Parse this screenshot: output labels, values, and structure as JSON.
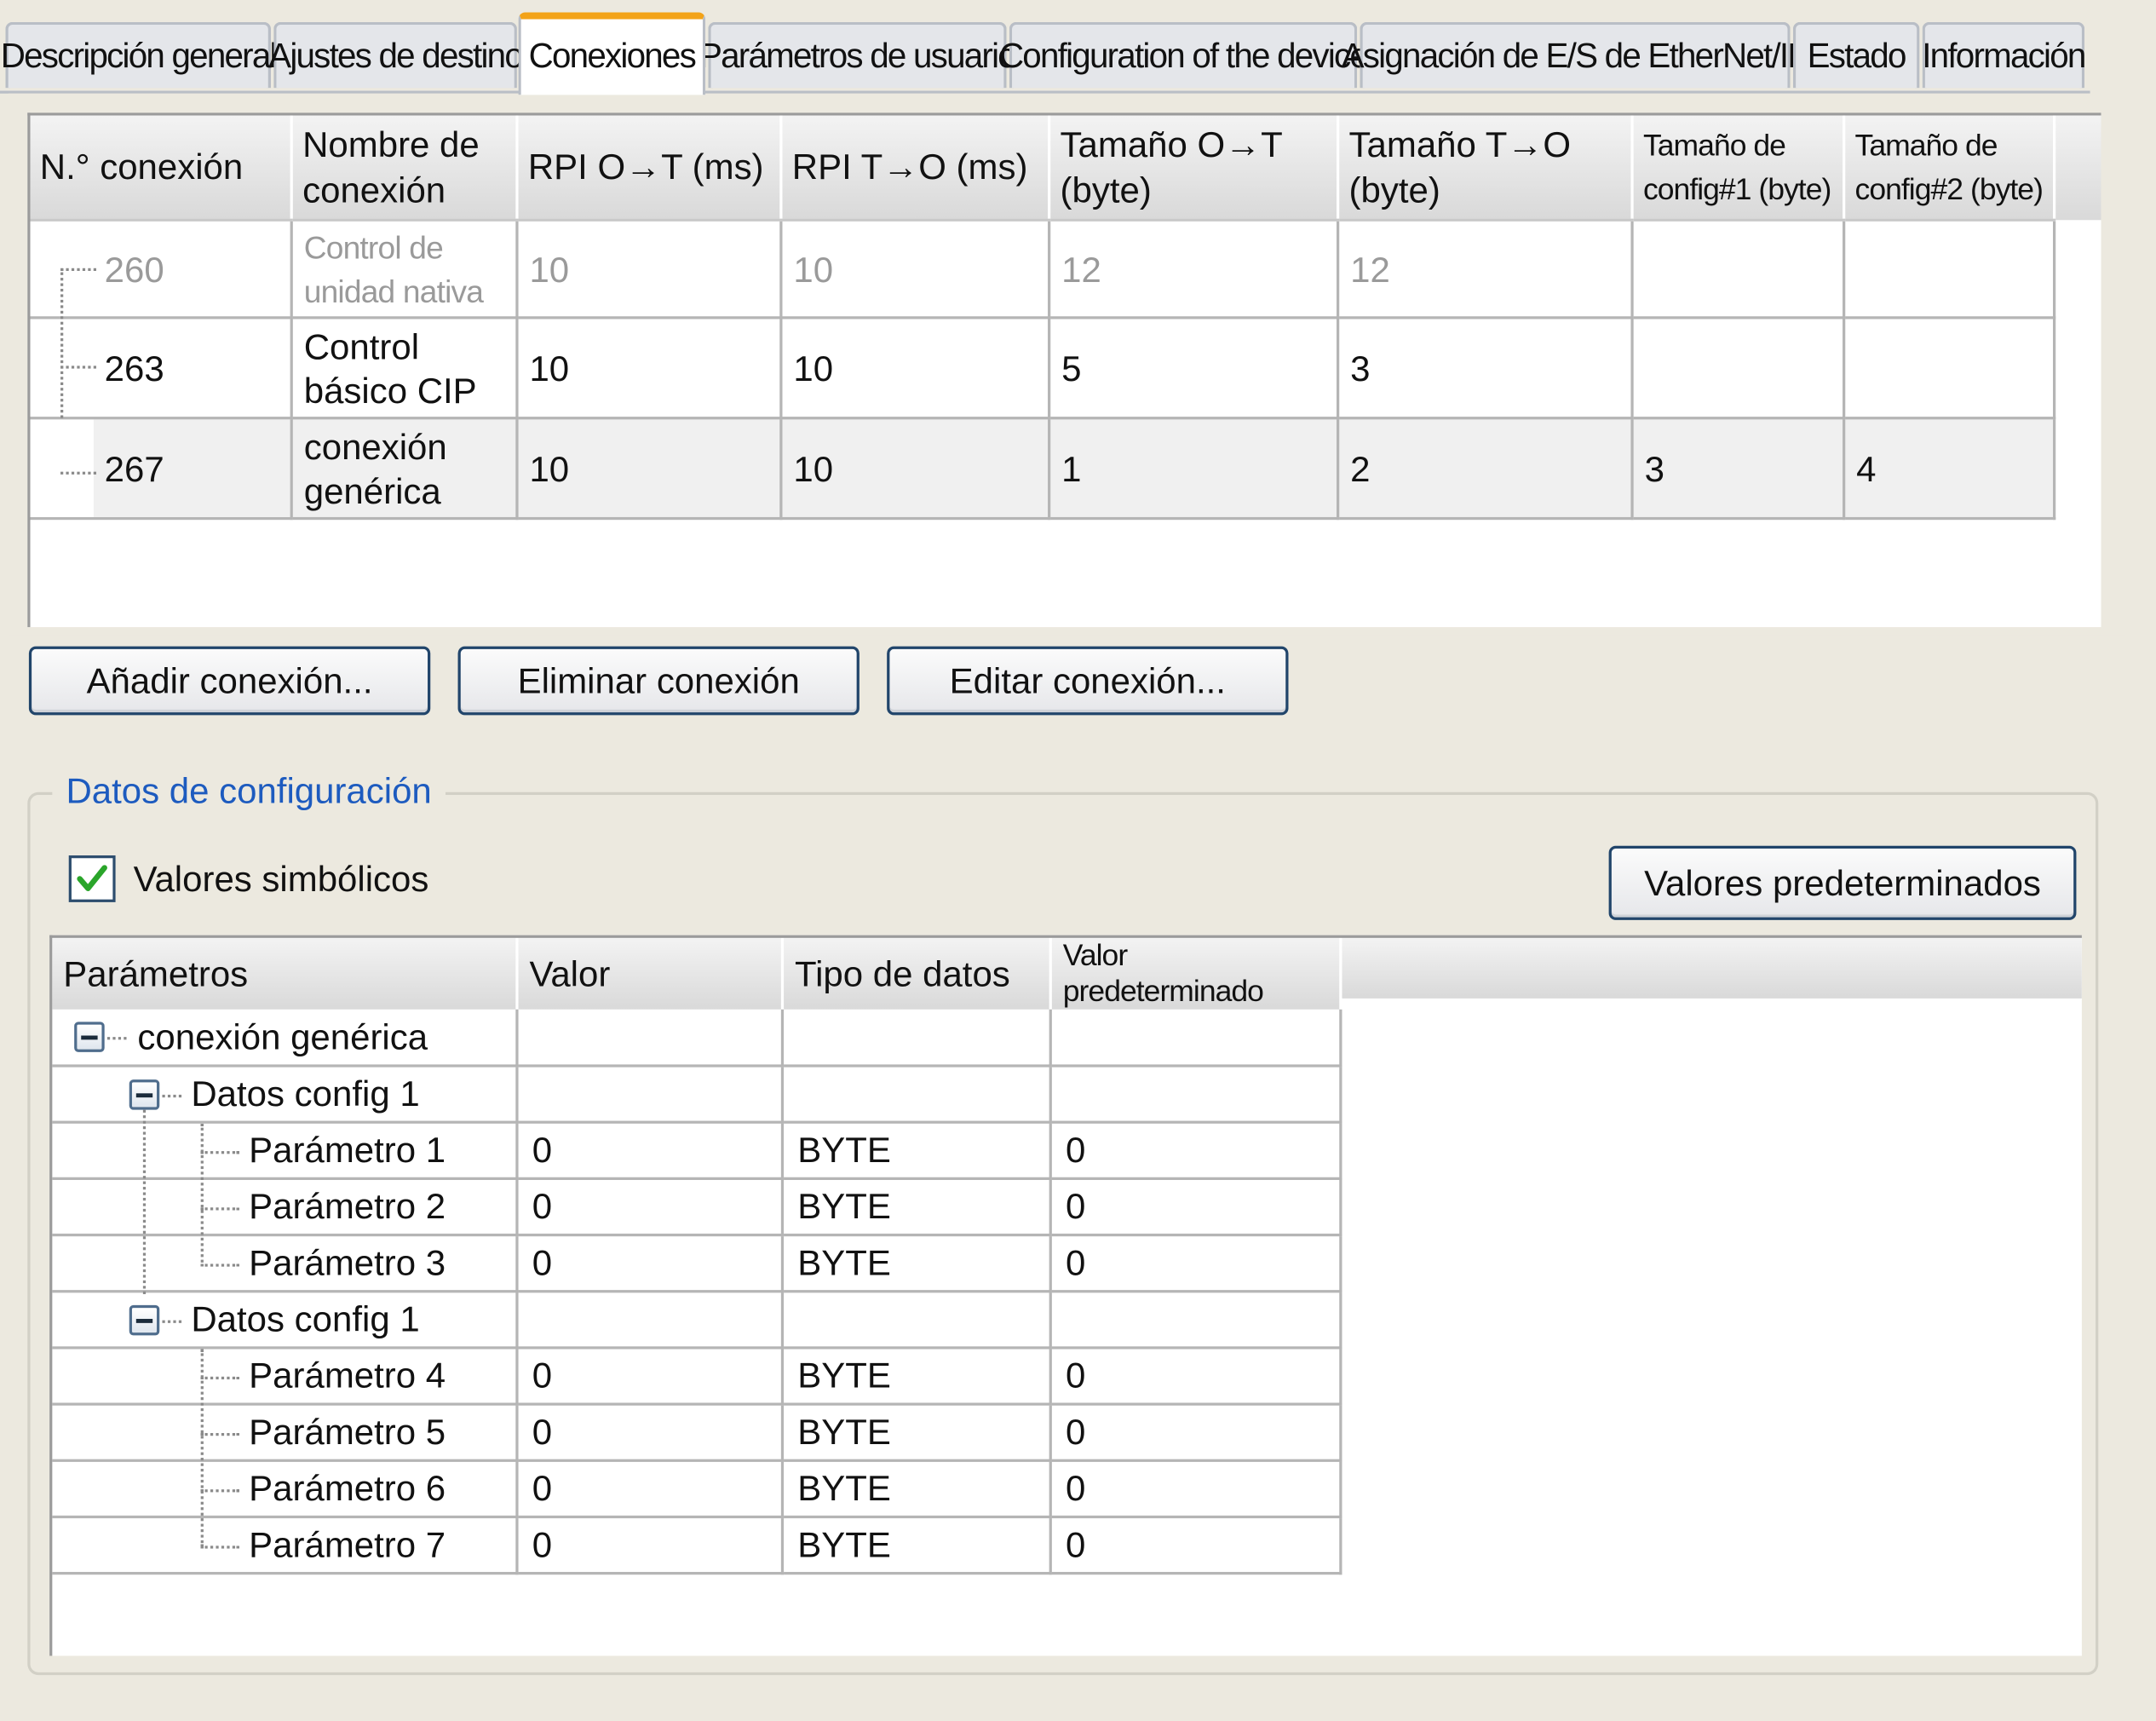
{
  "tabs": [
    {
      "label": "Descripción general",
      "active": false
    },
    {
      "label": "Ajustes de destino",
      "active": false
    },
    {
      "label": "Conexiones",
      "active": true
    },
    {
      "label": "Parámetros de usuario",
      "active": false
    },
    {
      "label": "Configuration of the device",
      "active": false
    },
    {
      "label": "Asignación de E/S de EtherNet/IP",
      "active": false
    },
    {
      "label": "Estado",
      "active": false
    },
    {
      "label": "Información",
      "active": false
    }
  ],
  "connections": {
    "headers": [
      "N.° conexión",
      "Nombre de conexión",
      "RPI O→T (ms)",
      "RPI T→O (ms)",
      "Tamaño O→T (byte)",
      "Tamaño T→O (byte)",
      "Tamaño de config#1 (byte)",
      "Tamaño de config#2 (byte)"
    ],
    "rows": [
      {
        "id": "260",
        "name": "Control de unidad nativa",
        "rpi_ot": "10",
        "rpi_to": "10",
        "size_ot": "12",
        "size_to": "12",
        "cfg1": "",
        "cfg2": "",
        "state": "disabled"
      },
      {
        "id": "263",
        "name": "Control básico CIP",
        "rpi_ot": "10",
        "rpi_to": "10",
        "size_ot": "5",
        "size_to": "3",
        "cfg1": "",
        "cfg2": "",
        "state": "normal"
      },
      {
        "id": "267",
        "name": "conexión genérica",
        "rpi_ot": "10",
        "rpi_to": "10",
        "size_ot": "1",
        "size_to": "2",
        "cfg1": "3",
        "cfg2": "4",
        "state": "selected"
      }
    ]
  },
  "buttons": {
    "add": "Añadir conexión...",
    "delete": "Eliminar conexión",
    "edit": "Editar conexión..."
  },
  "config": {
    "group_title": "Datos de configuración",
    "symbolic_label": "Valores simbólicos",
    "symbolic_checked": true,
    "defaults_button": "Valores predeterminados",
    "headers": [
      "Parámetros",
      "Valor",
      "Tipo de datos",
      "Valor predeterminado"
    ],
    "root": "conexión genérica",
    "groups": [
      {
        "label": "Datos config 1",
        "params": [
          {
            "name": "Parámetro 1",
            "value": "0",
            "type": "BYTE",
            "default": "0"
          },
          {
            "name": "Parámetro 2",
            "value": "0",
            "type": "BYTE",
            "default": "0"
          },
          {
            "name": "Parámetro 3",
            "value": "0",
            "type": "BYTE",
            "default": "0"
          }
        ]
      },
      {
        "label": "Datos config 1",
        "params": [
          {
            "name": "Parámetro 4",
            "value": "0",
            "type": "BYTE",
            "default": "0"
          },
          {
            "name": "Parámetro 5",
            "value": "0",
            "type": "BYTE",
            "default": "0"
          },
          {
            "name": "Parámetro 6",
            "value": "0",
            "type": "BYTE",
            "default": "0"
          },
          {
            "name": "Parámetro 7",
            "value": "0",
            "type": "BYTE",
            "default": "0"
          }
        ]
      }
    ]
  },
  "colors": {
    "active_tab_accent": "#f3a318",
    "group_title": "#1d5bbf",
    "checkmark": "#2aa52a",
    "button_border": "#21456b"
  },
  "icons": [
    "checkbox-check-icon",
    "collapse-icon"
  ]
}
